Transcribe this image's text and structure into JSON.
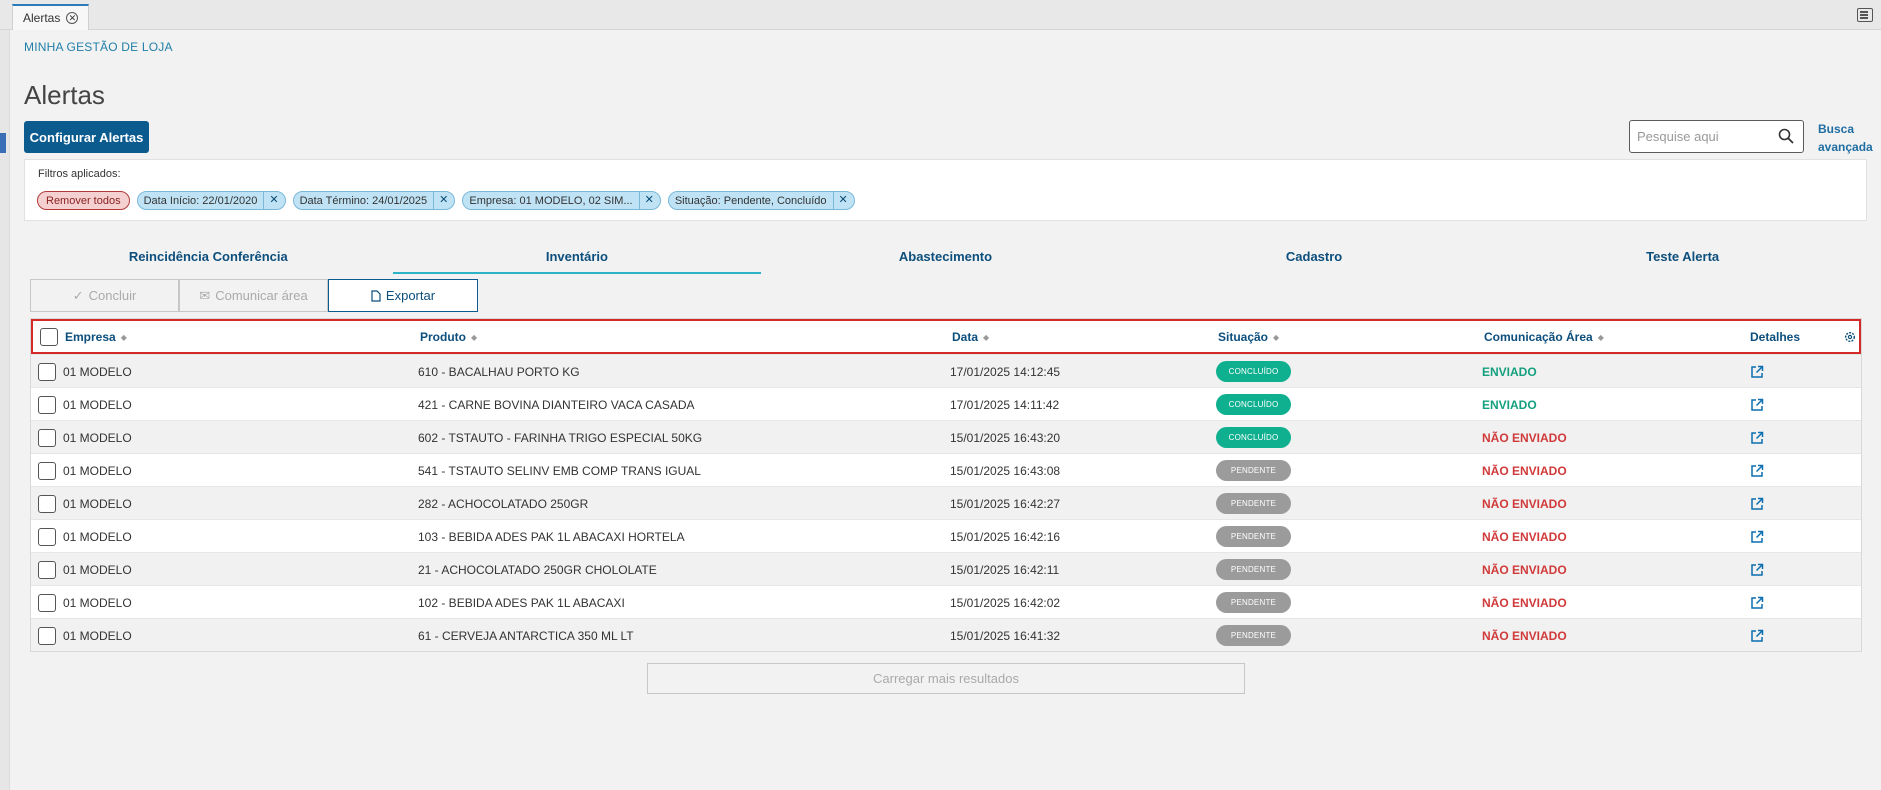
{
  "window": {
    "tab_label": "Alertas"
  },
  "breadcrumb": "MINHA GESTÃO DE LOJA",
  "page_title": "Alertas",
  "configure_button": "Configurar Alertas",
  "search": {
    "placeholder": "Pesquise aqui",
    "advanced_label": "Busca avançada"
  },
  "filters": {
    "label": "Filtros aplicados:",
    "remove_all": "Remover todos",
    "chips": [
      "Data Início: 22/01/2020",
      "Data Término: 24/01/2025",
      "Empresa: 01 MODELO, 02 SIM...",
      "Situação: Pendente, Concluído"
    ]
  },
  "tabs": [
    {
      "label": "Reincidência Conferência",
      "active": false
    },
    {
      "label": "Inventário",
      "active": true
    },
    {
      "label": "Abastecimento",
      "active": false
    },
    {
      "label": "Cadastro",
      "active": false
    },
    {
      "label": "Teste Alerta",
      "active": false
    }
  ],
  "actions": {
    "conclude": "Concluir",
    "communicate": "Comunicar área",
    "export": "Exportar"
  },
  "table": {
    "headers": {
      "empresa": "Empresa",
      "produto": "Produto",
      "data": "Data",
      "situacao": "Situação",
      "comunicacao": "Comunicação Área",
      "detalhes": "Detalhes"
    },
    "rows": [
      {
        "empresa": "01 MODELO",
        "produto": "610 - BACALHAU PORTO KG",
        "data": "17/01/2025 14:12:45",
        "situacao": "CONCLUÍDO",
        "comunicacao": "ENVIADO"
      },
      {
        "empresa": "01 MODELO",
        "produto": "421 - CARNE BOVINA DIANTEIRO VACA CASADA",
        "data": "17/01/2025 14:11:42",
        "situacao": "CONCLUÍDO",
        "comunicacao": "ENVIADO"
      },
      {
        "empresa": "01 MODELO",
        "produto": "602 - TSTAUTO - FARINHA TRIGO ESPECIAL 50KG",
        "data": "15/01/2025 16:43:20",
        "situacao": "CONCLUÍDO",
        "comunicacao": "NÃO ENVIADO"
      },
      {
        "empresa": "01 MODELO",
        "produto": "541 - TSTAUTO SELINV EMB COMP TRANS IGUAL",
        "data": "15/01/2025 16:43:08",
        "situacao": "PENDENTE",
        "comunicacao": "NÃO ENVIADO"
      },
      {
        "empresa": "01 MODELO",
        "produto": "282 - ACHOCOLATADO 250GR",
        "data": "15/01/2025 16:42:27",
        "situacao": "PENDENTE",
        "comunicacao": "NÃO ENVIADO"
      },
      {
        "empresa": "01 MODELO",
        "produto": "103 - BEBIDA ADES PAK 1L ABACAXI HORTELA",
        "data": "15/01/2025 16:42:16",
        "situacao": "PENDENTE",
        "comunicacao": "NÃO ENVIADO"
      },
      {
        "empresa": "01 MODELO",
        "produto": "21 - ACHOCOLATADO 250GR CHOLOLATE",
        "data": "15/01/2025 16:42:11",
        "situacao": "PENDENTE",
        "comunicacao": "NÃO ENVIADO"
      },
      {
        "empresa": "01 MODELO",
        "produto": "102 - BEBIDA ADES PAK 1L ABACAXI",
        "data": "15/01/2025 16:42:02",
        "situacao": "PENDENTE",
        "comunicacao": "NÃO ENVIADO"
      },
      {
        "empresa": "01 MODELO",
        "produto": "61 - CERVEJA ANTARCTICA 350 ML LT",
        "data": "15/01/2025 16:41:32",
        "situacao": "PENDENTE",
        "comunicacao": "NÃO ENVIADO"
      }
    ]
  },
  "load_more": "Carregar mais resultados",
  "colors": {
    "primary": "#0c5b8f",
    "link": "#0c4e7c",
    "success": "#0fb08f",
    "pending": "#9b9b9b",
    "danger": "#d13a3a",
    "tab_accent": "#2db3c8",
    "highlight_border": "#d42a2a"
  }
}
